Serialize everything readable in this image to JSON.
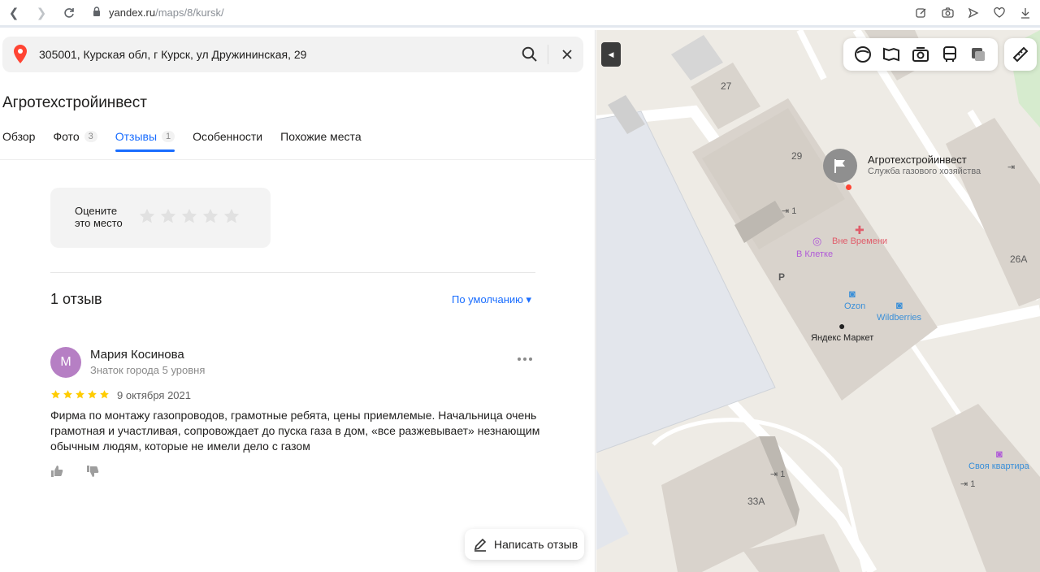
{
  "browser": {
    "url_host": "yandex.ru",
    "url_path": "/maps/8/kursk/"
  },
  "search": {
    "value": "305001, Курская обл, г Курск, ул Дружининская, 29"
  },
  "org": {
    "title": "Агротехстройинвест"
  },
  "tabs": [
    {
      "label": "Обзор",
      "count": ""
    },
    {
      "label": "Фото",
      "count": "3"
    },
    {
      "label": "Отзывы",
      "count": "1"
    },
    {
      "label": "Особенности",
      "count": ""
    },
    {
      "label": "Похожие места",
      "count": ""
    }
  ],
  "rating_prompt": {
    "label_line1": "Оцените",
    "label_line2": "это место"
  },
  "reviews": {
    "count_label": "1 отзыв",
    "sort_label": "По умолчанию ▾",
    "items": [
      {
        "avatar_letter": "M",
        "author": "Мария Косинова",
        "author_sub": "Знаток города 5 уровня",
        "stars": 5,
        "date": "9 октября 2021",
        "text": "Фирма по монтажу газопроводов, грамотные ребята, цены приемлемые. Начальница очень грамотная и участливая, сопровождает до пуска газа в дом, «все разжевывает» незнающим обычным людям, которые не имели дело с газом"
      }
    ]
  },
  "write_review_label": "Написать отзыв",
  "map": {
    "poi_title": "Агротехстройинвест",
    "poi_sub": "Служба газового хозяйства",
    "labels": {
      "b27": "27",
      "b29": "29",
      "b26a": "26А",
      "b33a": "33А",
      "entr1a": "1",
      "entr1b": "1",
      "entr1c": "1",
      "parking": "P",
      "vne_vremeni": "Вне Времени",
      "v_kletke": "В Клетке",
      "ozon": "Ozon",
      "wildberries": "Wildberries",
      "yandex_market": "Яндекс Маркет",
      "svoya_kvartira": "Своя квартира"
    }
  },
  "colors": {
    "accent": "#196dff",
    "star": "#fc0",
    "avatar": "#b67fc4",
    "pin": "#ff4433"
  }
}
